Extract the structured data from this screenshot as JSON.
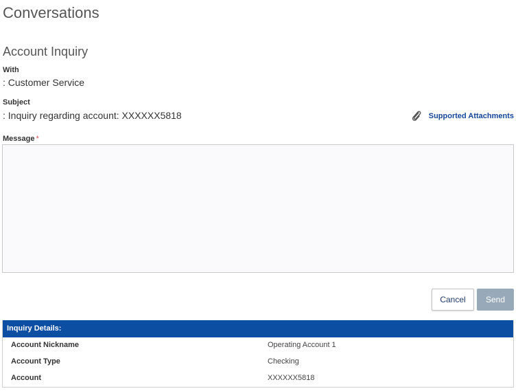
{
  "page": {
    "title": "Conversations",
    "section_title": "Account Inquiry"
  },
  "with": {
    "label": "With",
    "value": ": Customer Service"
  },
  "subject": {
    "label": "Subject",
    "value": ": Inquiry regarding account: XXXXXX5818"
  },
  "attachments": {
    "label": "Supported Attachments",
    "icon": "paperclip-icon"
  },
  "message": {
    "label": "Message",
    "required_marker": "*",
    "value": "",
    "placeholder": ""
  },
  "actions": {
    "cancel_label": "Cancel",
    "send_label": "Send"
  },
  "inquiry_details": {
    "header": "Inquiry Details:",
    "rows": [
      {
        "key": "Account Nickname",
        "value": "Operating Account 1"
      },
      {
        "key": "Account Type",
        "value": "Checking"
      },
      {
        "key": "Account",
        "value": "XXXXXX5818"
      }
    ]
  },
  "colors": {
    "header_bg": "#0b4ea2",
    "link": "#14479a",
    "send_disabled": "#98aab9",
    "required": "#d9534f"
  }
}
